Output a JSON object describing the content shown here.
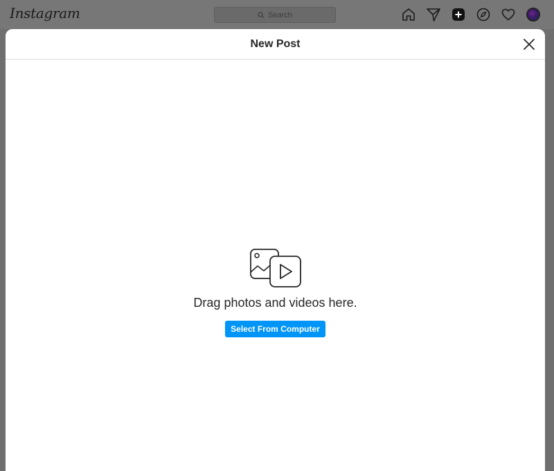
{
  "topbar": {
    "logo_text": "Instagram",
    "search": {
      "placeholder": "Search",
      "icon": "search-icon"
    },
    "nav_icons": [
      "home-icon",
      "direct-icon",
      "new-post-icon",
      "explore-icon",
      "heart-icon",
      "avatar"
    ]
  },
  "modal": {
    "title": "New Post",
    "close_icon": "close-icon",
    "upload": {
      "icon": "photo-video-icon",
      "message": "Drag photos and videos here.",
      "button_label": "Select From Computer"
    }
  },
  "colors": {
    "accent": "#0095f6",
    "overlay": "#6f6f6f",
    "modal_background": "#ffffff",
    "text": "#262626"
  }
}
